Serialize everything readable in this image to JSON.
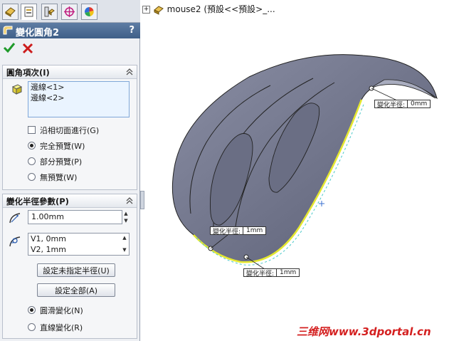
{
  "tabs": [
    {
      "name": "feature-manager-tab-icon"
    },
    {
      "name": "property-manager-tab-icon"
    },
    {
      "name": "configuration-manager-tab-icon"
    },
    {
      "name": "dimxpert-manager-tab-icon"
    },
    {
      "name": "display-manager-tab-icon"
    }
  ],
  "header": {
    "title": "變化圓角2",
    "help": "?"
  },
  "fillet_items": {
    "title": "圓角項次(I)",
    "edges": [
      "邊線<1>",
      "邊線<2>"
    ],
    "tangent_propagation": "沿相切面進行(G)",
    "preview_options": [
      "完全預覽(W)",
      "部分預覽(P)",
      "無預覽(W)"
    ],
    "preview_selected": 0
  },
  "variable_radius": {
    "title": "變化半徑參數(P)",
    "radius_value": "1.00mm",
    "vertices": [
      "V1, 0mm",
      "V2, 1mm"
    ],
    "set_unassigned_label": "設定未指定半徑(U)",
    "set_all_label": "設定全部(A)",
    "transition_options": [
      "圓滑變化(N)",
      "直線變化(R)"
    ],
    "transition_selected": 0
  },
  "tree": {
    "label": "mouse2 (預設<<預設>_..."
  },
  "callouts": [
    {
      "key": "變化半徑:",
      "value": "0mm"
    },
    {
      "key": "變化半徑:",
      "value": "1mm"
    },
    {
      "key": "變化半徑:",
      "value": "1mm"
    }
  ],
  "colors": {
    "header": "#4a6a94",
    "model": "#6e7288",
    "edge_highlight": "#e5e830"
  },
  "watermark": "三维网www.3dportal.cn"
}
